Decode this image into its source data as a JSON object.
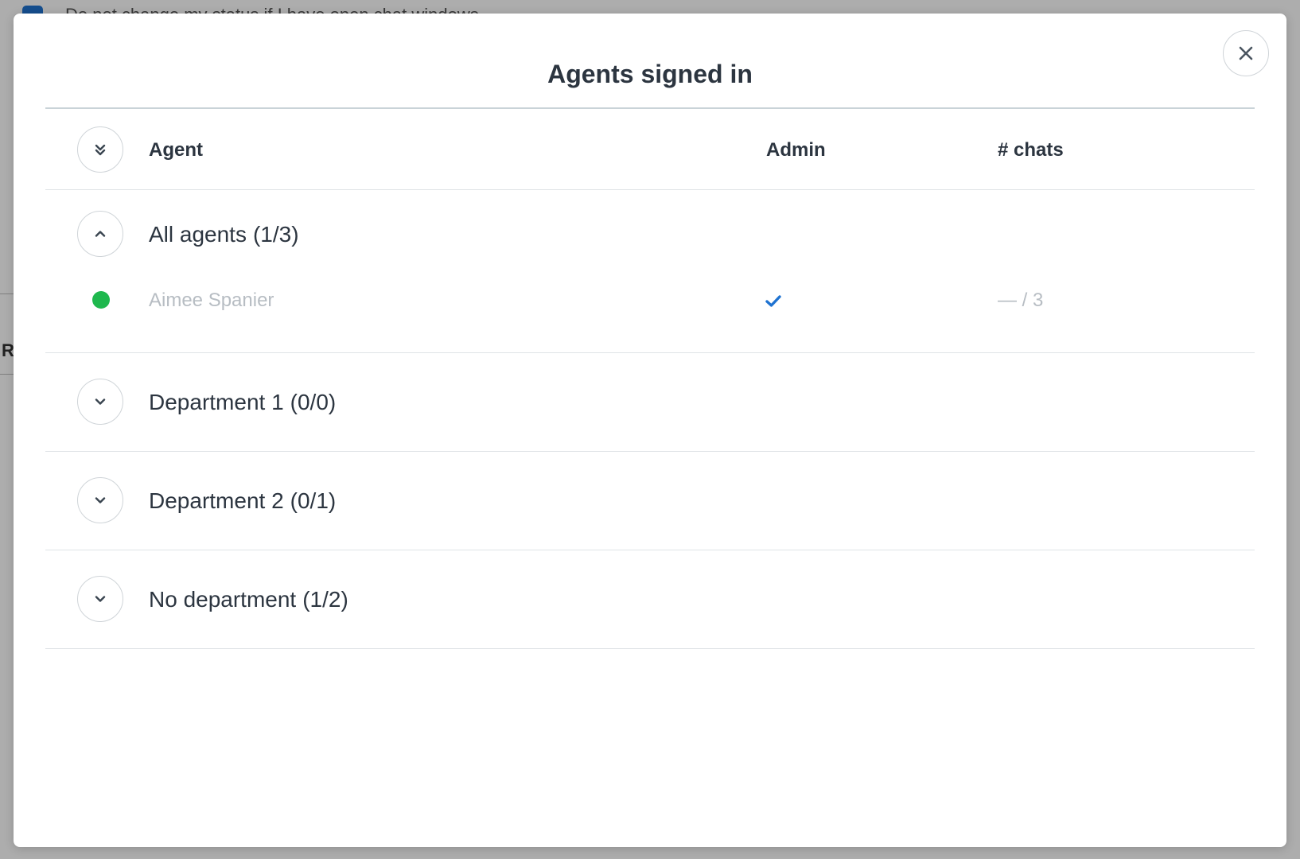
{
  "background": {
    "option_text": "Do not change my status if I have open chat windows",
    "letter": "R"
  },
  "modal": {
    "title": "Agents signed in",
    "close_icon": "close-icon"
  },
  "table": {
    "headers": {
      "toggle_all_icon": "double-chevron-down-icon",
      "agent": "Agent",
      "admin": "Admin",
      "chats": "# chats"
    },
    "groups": [
      {
        "name": "All agents",
        "count": "(1/3)",
        "expanded": true,
        "agents": [
          {
            "name": "Aimee Spanier",
            "status": "online",
            "status_color": "#1fb84e",
            "admin": true,
            "chats": "— / 3"
          }
        ]
      },
      {
        "name": "Department 1",
        "count": "(0/0)",
        "expanded": false
      },
      {
        "name": "Department 2",
        "count": "(0/1)",
        "expanded": false
      },
      {
        "name": "No department",
        "count": "(1/2)",
        "expanded": false
      }
    ]
  },
  "colors": {
    "text": "#2c3540",
    "muted_text": "#b7bdc3",
    "check": "#1f73d1",
    "online": "#1fb84e"
  }
}
